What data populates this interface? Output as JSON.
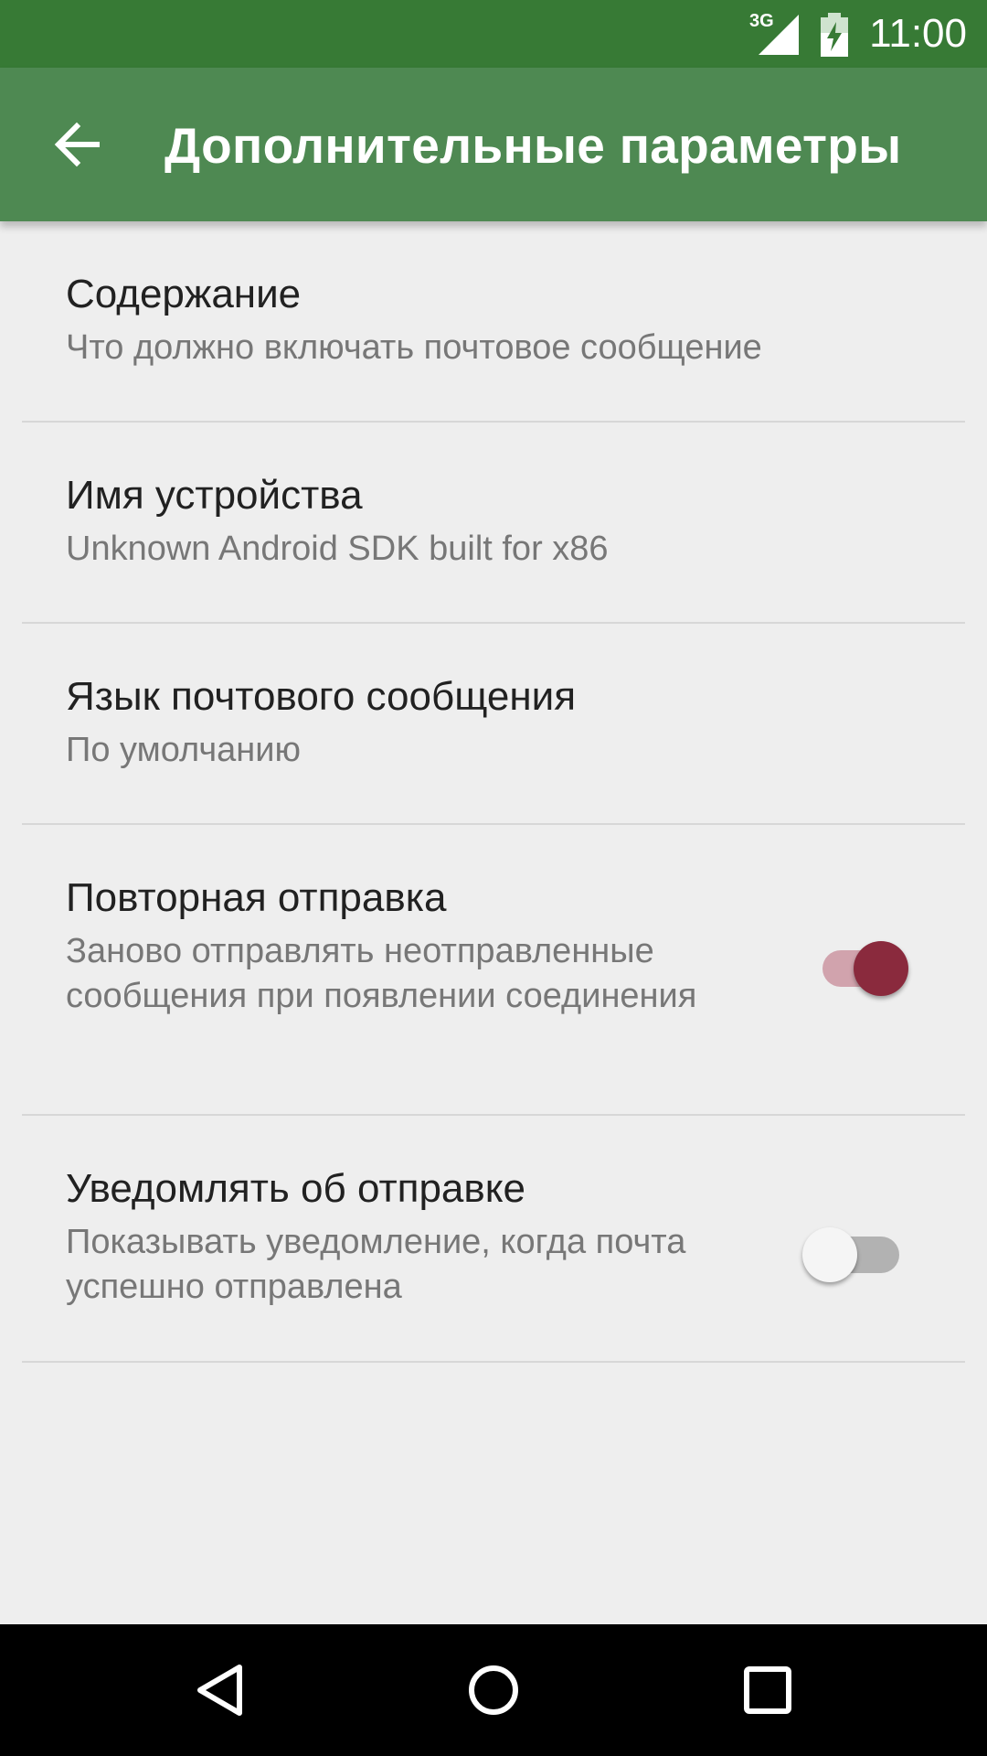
{
  "status_bar": {
    "network": "3G",
    "time": "11:00",
    "icons": [
      "signal-icon",
      "battery-charging-icon"
    ],
    "color": "#377a35"
  },
  "app_bar": {
    "title": "Дополнительные параметры",
    "back_icon": "arrow-back-icon",
    "color": "#4e8952"
  },
  "settings": [
    {
      "title": "Содержание",
      "summary": "Что должно включать почтовое сообщение"
    },
    {
      "title": "Имя устройства",
      "summary": "Unknown Android SDK built for x86"
    },
    {
      "title": "Язык почтового сообщения",
      "summary": "По умолчанию"
    },
    {
      "title": "Повторная отправка",
      "summary": "Заново отправлять неотправленные сообщения при появлении соединения",
      "toggle": true
    },
    {
      "title": "Уведомлять об отправке",
      "summary": "Показывать уведомление, когда почта успешно отправлена",
      "toggle": false
    }
  ],
  "toggle_colors": {
    "on_thumb": "#8a2a3d",
    "on_track": "#d1a3ad",
    "off_thumb": "#f5f5f5",
    "off_track": "#b2b2b2"
  },
  "nav_bar": {
    "icons": [
      "back-triangle-icon",
      "home-circle-icon",
      "recents-square-icon"
    ]
  }
}
